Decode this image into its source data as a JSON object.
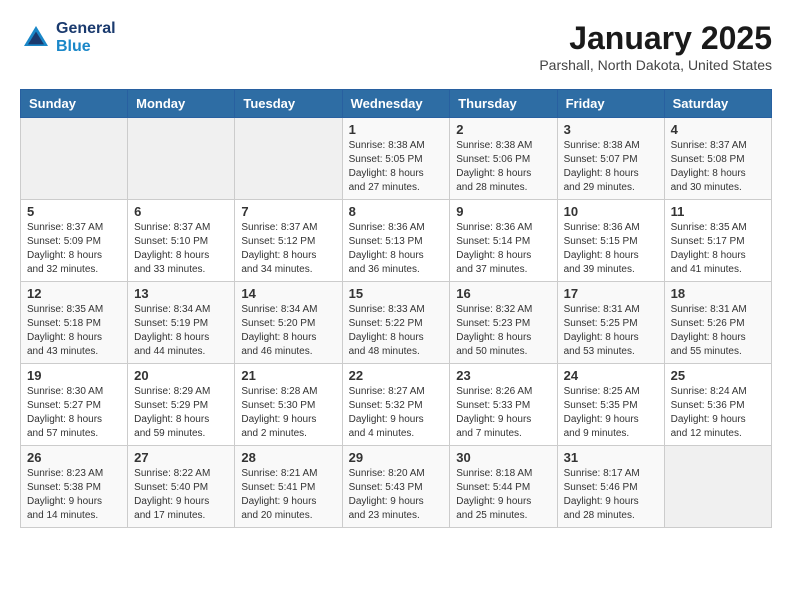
{
  "header": {
    "logo_line1": "General",
    "logo_line2": "Blue",
    "title": "January 2025",
    "subtitle": "Parshall, North Dakota, United States"
  },
  "calendar": {
    "days_of_week": [
      "Sunday",
      "Monday",
      "Tuesday",
      "Wednesday",
      "Thursday",
      "Friday",
      "Saturday"
    ],
    "weeks": [
      [
        {
          "day": "",
          "content": ""
        },
        {
          "day": "",
          "content": ""
        },
        {
          "day": "",
          "content": ""
        },
        {
          "day": "1",
          "content": "Sunrise: 8:38 AM\nSunset: 5:05 PM\nDaylight: 8 hours\nand 27 minutes."
        },
        {
          "day": "2",
          "content": "Sunrise: 8:38 AM\nSunset: 5:06 PM\nDaylight: 8 hours\nand 28 minutes."
        },
        {
          "day": "3",
          "content": "Sunrise: 8:38 AM\nSunset: 5:07 PM\nDaylight: 8 hours\nand 29 minutes."
        },
        {
          "day": "4",
          "content": "Sunrise: 8:37 AM\nSunset: 5:08 PM\nDaylight: 8 hours\nand 30 minutes."
        }
      ],
      [
        {
          "day": "5",
          "content": "Sunrise: 8:37 AM\nSunset: 5:09 PM\nDaylight: 8 hours\nand 32 minutes."
        },
        {
          "day": "6",
          "content": "Sunrise: 8:37 AM\nSunset: 5:10 PM\nDaylight: 8 hours\nand 33 minutes."
        },
        {
          "day": "7",
          "content": "Sunrise: 8:37 AM\nSunset: 5:12 PM\nDaylight: 8 hours\nand 34 minutes."
        },
        {
          "day": "8",
          "content": "Sunrise: 8:36 AM\nSunset: 5:13 PM\nDaylight: 8 hours\nand 36 minutes."
        },
        {
          "day": "9",
          "content": "Sunrise: 8:36 AM\nSunset: 5:14 PM\nDaylight: 8 hours\nand 37 minutes."
        },
        {
          "day": "10",
          "content": "Sunrise: 8:36 AM\nSunset: 5:15 PM\nDaylight: 8 hours\nand 39 minutes."
        },
        {
          "day": "11",
          "content": "Sunrise: 8:35 AM\nSunset: 5:17 PM\nDaylight: 8 hours\nand 41 minutes."
        }
      ],
      [
        {
          "day": "12",
          "content": "Sunrise: 8:35 AM\nSunset: 5:18 PM\nDaylight: 8 hours\nand 43 minutes."
        },
        {
          "day": "13",
          "content": "Sunrise: 8:34 AM\nSunset: 5:19 PM\nDaylight: 8 hours\nand 44 minutes."
        },
        {
          "day": "14",
          "content": "Sunrise: 8:34 AM\nSunset: 5:20 PM\nDaylight: 8 hours\nand 46 minutes."
        },
        {
          "day": "15",
          "content": "Sunrise: 8:33 AM\nSunset: 5:22 PM\nDaylight: 8 hours\nand 48 minutes."
        },
        {
          "day": "16",
          "content": "Sunrise: 8:32 AM\nSunset: 5:23 PM\nDaylight: 8 hours\nand 50 minutes."
        },
        {
          "day": "17",
          "content": "Sunrise: 8:31 AM\nSunset: 5:25 PM\nDaylight: 8 hours\nand 53 minutes."
        },
        {
          "day": "18",
          "content": "Sunrise: 8:31 AM\nSunset: 5:26 PM\nDaylight: 8 hours\nand 55 minutes."
        }
      ],
      [
        {
          "day": "19",
          "content": "Sunrise: 8:30 AM\nSunset: 5:27 PM\nDaylight: 8 hours\nand 57 minutes."
        },
        {
          "day": "20",
          "content": "Sunrise: 8:29 AM\nSunset: 5:29 PM\nDaylight: 8 hours\nand 59 minutes."
        },
        {
          "day": "21",
          "content": "Sunrise: 8:28 AM\nSunset: 5:30 PM\nDaylight: 9 hours\nand 2 minutes."
        },
        {
          "day": "22",
          "content": "Sunrise: 8:27 AM\nSunset: 5:32 PM\nDaylight: 9 hours\nand 4 minutes."
        },
        {
          "day": "23",
          "content": "Sunrise: 8:26 AM\nSunset: 5:33 PM\nDaylight: 9 hours\nand 7 minutes."
        },
        {
          "day": "24",
          "content": "Sunrise: 8:25 AM\nSunset: 5:35 PM\nDaylight: 9 hours\nand 9 minutes."
        },
        {
          "day": "25",
          "content": "Sunrise: 8:24 AM\nSunset: 5:36 PM\nDaylight: 9 hours\nand 12 minutes."
        }
      ],
      [
        {
          "day": "26",
          "content": "Sunrise: 8:23 AM\nSunset: 5:38 PM\nDaylight: 9 hours\nand 14 minutes."
        },
        {
          "day": "27",
          "content": "Sunrise: 8:22 AM\nSunset: 5:40 PM\nDaylight: 9 hours\nand 17 minutes."
        },
        {
          "day": "28",
          "content": "Sunrise: 8:21 AM\nSunset: 5:41 PM\nDaylight: 9 hours\nand 20 minutes."
        },
        {
          "day": "29",
          "content": "Sunrise: 8:20 AM\nSunset: 5:43 PM\nDaylight: 9 hours\nand 23 minutes."
        },
        {
          "day": "30",
          "content": "Sunrise: 8:18 AM\nSunset: 5:44 PM\nDaylight: 9 hours\nand 25 minutes."
        },
        {
          "day": "31",
          "content": "Sunrise: 8:17 AM\nSunset: 5:46 PM\nDaylight: 9 hours\nand 28 minutes."
        },
        {
          "day": "",
          "content": ""
        }
      ]
    ]
  }
}
